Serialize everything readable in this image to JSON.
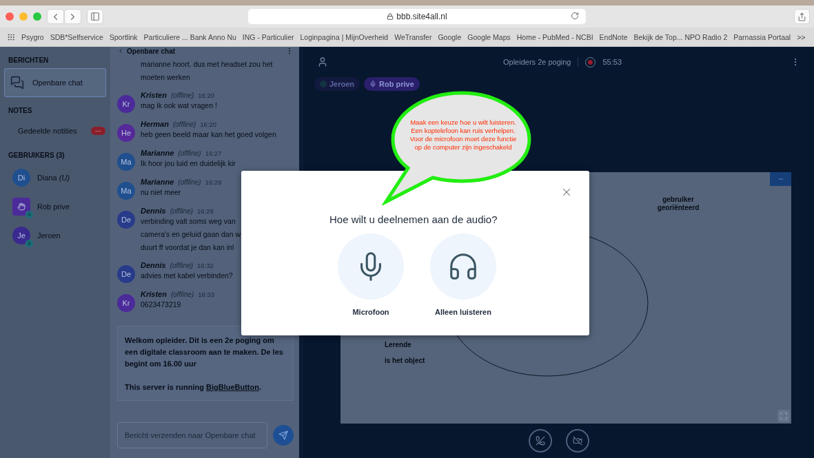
{
  "browser": {
    "address": "bbb.site4all.nl",
    "bookmarks": [
      "Psygro",
      "SDB*Selfservice",
      "Sportlink",
      "Particuliere ... Bank Anno Nu",
      "ING - Particulier",
      "Loginpagina | MijnOverheid",
      "WeTransfer",
      "Google",
      "Google Maps",
      "Home - PubMed - NCBI",
      "EndNote",
      "Bekijk de Top... NPO Radio 2",
      "Parnassia Portaal"
    ],
    "more": ">>"
  },
  "sidebar": {
    "messages_title": "BERICHTEN",
    "chat_item": {
      "label": "Openbare chat",
      "selected": true
    },
    "notes_title": "NOTES",
    "notes_item": {
      "label": "Gedeelde notities",
      "badge": "···"
    },
    "users_title": "GEBRUIKERS (3)",
    "users": [
      {
        "initials": "Di",
        "name": "Diana *(U)*",
        "kind": "avatar",
        "audio": false,
        "color": "#1f4f8f"
      },
      {
        "name": "Rob prive",
        "kind": "raised-hand",
        "audio": true,
        "color": "#4b2a9a"
      },
      {
        "initials": "Je",
        "name": "Jeroen",
        "kind": "avatar",
        "audio": true,
        "color": "#3a2a8f"
      }
    ]
  },
  "chat": {
    "title": "Openbare chat",
    "messages": [
      {
        "lines": [
          "marianne hoort. dus met headset zou het",
          "moeten werken"
        ]
      },
      {
        "initials": "Kr",
        "author": "Kristen",
        "status": "(offline)",
        "time": "16:20",
        "color": "#4b2a9a",
        "lines": [
          "mag ik ook wat vragen !"
        ]
      },
      {
        "initials": "He",
        "author": "Herman",
        "status": "(offline)",
        "time": "16:20",
        "color": "#55299a",
        "lines": [
          "heb geen beeld maar kan het goed volgen"
        ]
      },
      {
        "initials": "Ma",
        "author": "Marianne",
        "status": "(offline)",
        "time": "16:27",
        "color": "#1f4f8f",
        "lines": [
          "Ik hoor jou luid en duidelijk kir"
        ]
      },
      {
        "initials": "Ma",
        "author": "Marianne",
        "status": "(offline)",
        "time": "16:28",
        "color": "#1f4f8f",
        "lines": [
          "nu niet meer"
        ]
      },
      {
        "initials": "De",
        "author": "Dennis",
        "status": "(offline)",
        "time": "16:29",
        "color": "#283b8a",
        "lines": [
          "verbinding valt soms weg van",
          "camera's en geluid gaan dan w",
          "duurt ff voordat je dan kan inl"
        ]
      },
      {
        "initials": "De",
        "author": "Dennis",
        "status": "(offline)",
        "time": "16:32",
        "color": "#283b8a",
        "lines": [
          "advies met kabel verbinden?"
        ]
      },
      {
        "initials": "Kr",
        "author": "Kristen",
        "status": "(offline)",
        "time": "16:33",
        "color": "#4b2a9a",
        "lines": [
          "0623473219"
        ]
      }
    ],
    "welcome": {
      "text": "Welkom opleider. Dit is een 2e poging om een digitale classroom aan te maken. De les begint om 16.00 uur",
      "server_prefix": "This server is running ",
      "server_link": "BigBlueButton",
      "server_suffix": "."
    },
    "input": {
      "placeholder": "Bericht verzenden naar Openbare chat"
    }
  },
  "main": {
    "title": "Opleiders 2e poging",
    "recording": true,
    "timer": "55:53",
    "talkers": [
      {
        "name": "Jeroen",
        "talking": false
      },
      {
        "name": "Rob prive",
        "talking": true
      }
    ],
    "slide": {
      "heading": "gebruiker\ngeoriënteerd",
      "labels": [
        "Lerende",
        "is het object"
      ]
    }
  },
  "modal": {
    "title": "Hoe wilt u deelnemen aan de audio?",
    "options": [
      {
        "kind": "microphone",
        "label": "Microfoon"
      },
      {
        "kind": "headphones",
        "label": "Alleen luisteren"
      }
    ]
  },
  "callout": {
    "text": "Maak een keuze hoe u wilt luisteren. Een koptelefoon kan ruis verhelpen. Voor de microfoon moet deze functie op de computer zijn ingeschakeld"
  }
}
